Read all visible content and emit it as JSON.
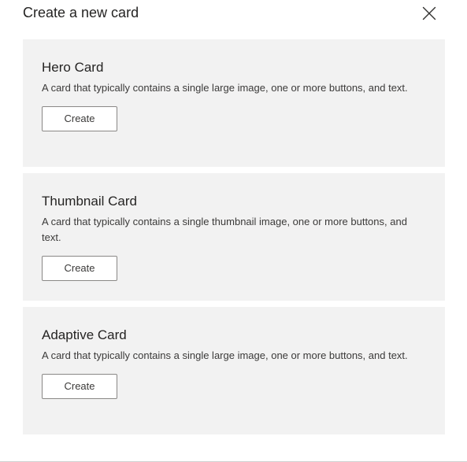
{
  "dialog": {
    "title": "Create a new card",
    "close_icon": "close-icon"
  },
  "cards": [
    {
      "title": "Hero Card",
      "description": "A card that typically contains a single large image, one or more buttons, and text.",
      "button_label": "Create"
    },
    {
      "title": "Thumbnail Card",
      "description": "A card that typically contains a single thumbnail image, one or more buttons, and text.",
      "button_label": "Create"
    },
    {
      "title": "Adaptive Card",
      "description": "A card that typically contains a single large image, one or more buttons, and text.",
      "button_label": "Create"
    }
  ],
  "colors": {
    "card_background": "#f2f2f2",
    "button_border": "#8a8886",
    "text": "#252423"
  }
}
